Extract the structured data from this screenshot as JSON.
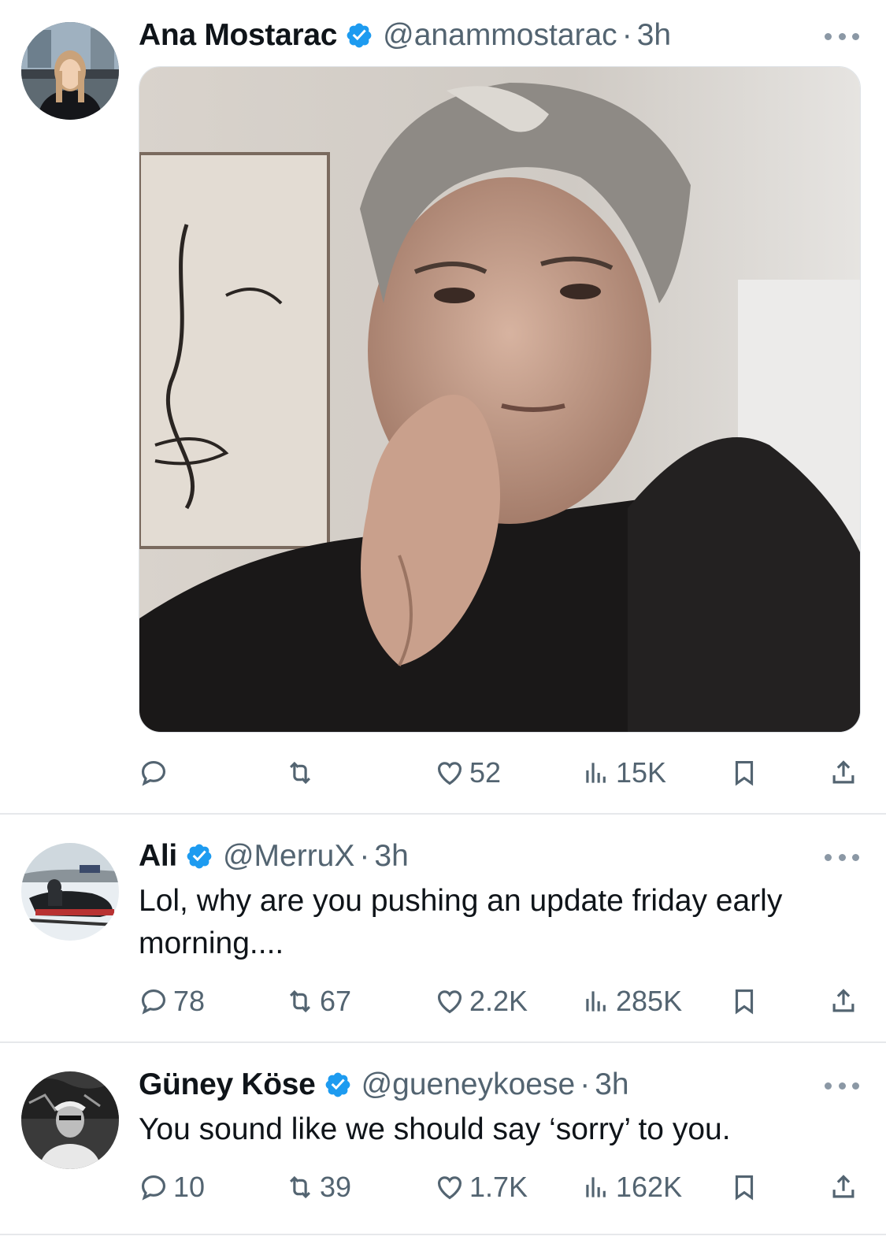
{
  "tweets": [
    {
      "name": "Ana Mostarac",
      "handle": "@anammostarac",
      "separator": "·",
      "time": "3h",
      "text": "",
      "has_media": true,
      "stats": {
        "replies": "",
        "reposts": "",
        "likes": "52",
        "views": "15K"
      }
    },
    {
      "name": "Ali",
      "handle": "@MerruX",
      "separator": "·",
      "time": "3h",
      "text": "Lol, why are you pushing an update friday early morning....",
      "has_media": false,
      "stats": {
        "replies": "78",
        "reposts": "67",
        "likes": "2.2K",
        "views": "285K"
      }
    },
    {
      "name": "Güney Köse",
      "handle": "@gueneykoese",
      "separator": "·",
      "time": "3h",
      "text": "You sound like we should say ‘sorry’ to you.",
      "has_media": false,
      "stats": {
        "replies": "10",
        "reposts": "39",
        "likes": "1.7K",
        "views": "162K"
      }
    }
  ],
  "icons": {
    "verified": "verified-badge-icon",
    "more": "more-dots-icon",
    "reply": "reply-icon",
    "repost": "repost-icon",
    "like": "heart-icon",
    "views": "views-chart-icon",
    "bookmark": "bookmark-icon",
    "share": "share-icon"
  },
  "colors": {
    "text_primary": "#0f1419",
    "text_secondary": "#536471",
    "verified_blue": "#1d9bf0",
    "divider": "#e6e8eb"
  }
}
